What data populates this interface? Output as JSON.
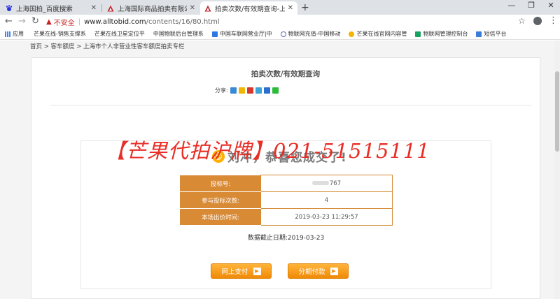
{
  "browser": {
    "tabs": [
      {
        "title": "上海国拍_百度搜索",
        "active": false
      },
      {
        "title": "上海国际商品拍卖有限公司-上海",
        "active": false
      },
      {
        "title": "拍卖次数/有效期查询-上海国际",
        "active": true
      }
    ],
    "address": {
      "security_label": "不安全",
      "url_host": "www.alltobid.com",
      "url_path": "/contents/16/80.html"
    },
    "bookmarks": [
      {
        "label": "应用",
        "icon": "apps-grid-icon"
      },
      {
        "label": "芒果在线-销售支撑系",
        "icon": "page-icon"
      },
      {
        "label": "芒果在线卫星定位平",
        "icon": "page-icon"
      },
      {
        "label": "中国物联后台管理系",
        "icon": "page-icon"
      },
      {
        "label": "中国车联网营业厅|中",
        "icon": "blue-square-icon"
      },
      {
        "label": "物联网充值-中国移动",
        "icon": "gear-icon"
      },
      {
        "label": "芒果在线官网内容管",
        "icon": "yellow-circle-icon"
      },
      {
        "label": "物联网管理控制台",
        "icon": "green-square-icon"
      },
      {
        "label": "短信平台",
        "icon": "blue-square-icon"
      }
    ]
  },
  "page": {
    "breadcrumb": "首页 > 客车额度 > 上海市个人非营业性客车额度拍卖专栏",
    "title": "拍卖次数/有效期查询",
    "share_label": "分享:",
    "share_icons": [
      {
        "name": "share-add-icon",
        "color": "#3a89d8"
      },
      {
        "name": "share-qzone-icon",
        "color": "#f2b705"
      },
      {
        "name": "share-weibo-icon",
        "color": "#d8382c"
      },
      {
        "name": "share-tencent-icon",
        "color": "#3ca4d8"
      },
      {
        "name": "share-renren-icon",
        "color": "#2a6fd0"
      },
      {
        "name": "share-wechat-icon",
        "color": "#2dbb3a"
      }
    ],
    "congrats_text": "刘冲，恭喜您成交了!",
    "info_rows": [
      {
        "label": "投标号:",
        "value": "767"
      },
      {
        "label": "参与投标次数:",
        "value": "4"
      },
      {
        "label": "本场出价时间:",
        "value": "2019-03-23 11:29:57"
      }
    ],
    "deadline": "数据截止日期:2019-03-23",
    "buttons": [
      {
        "label": "网上支付"
      },
      {
        "label": "分期付款"
      }
    ],
    "watermark": "【芒果代拍沪牌】021-51515111"
  }
}
